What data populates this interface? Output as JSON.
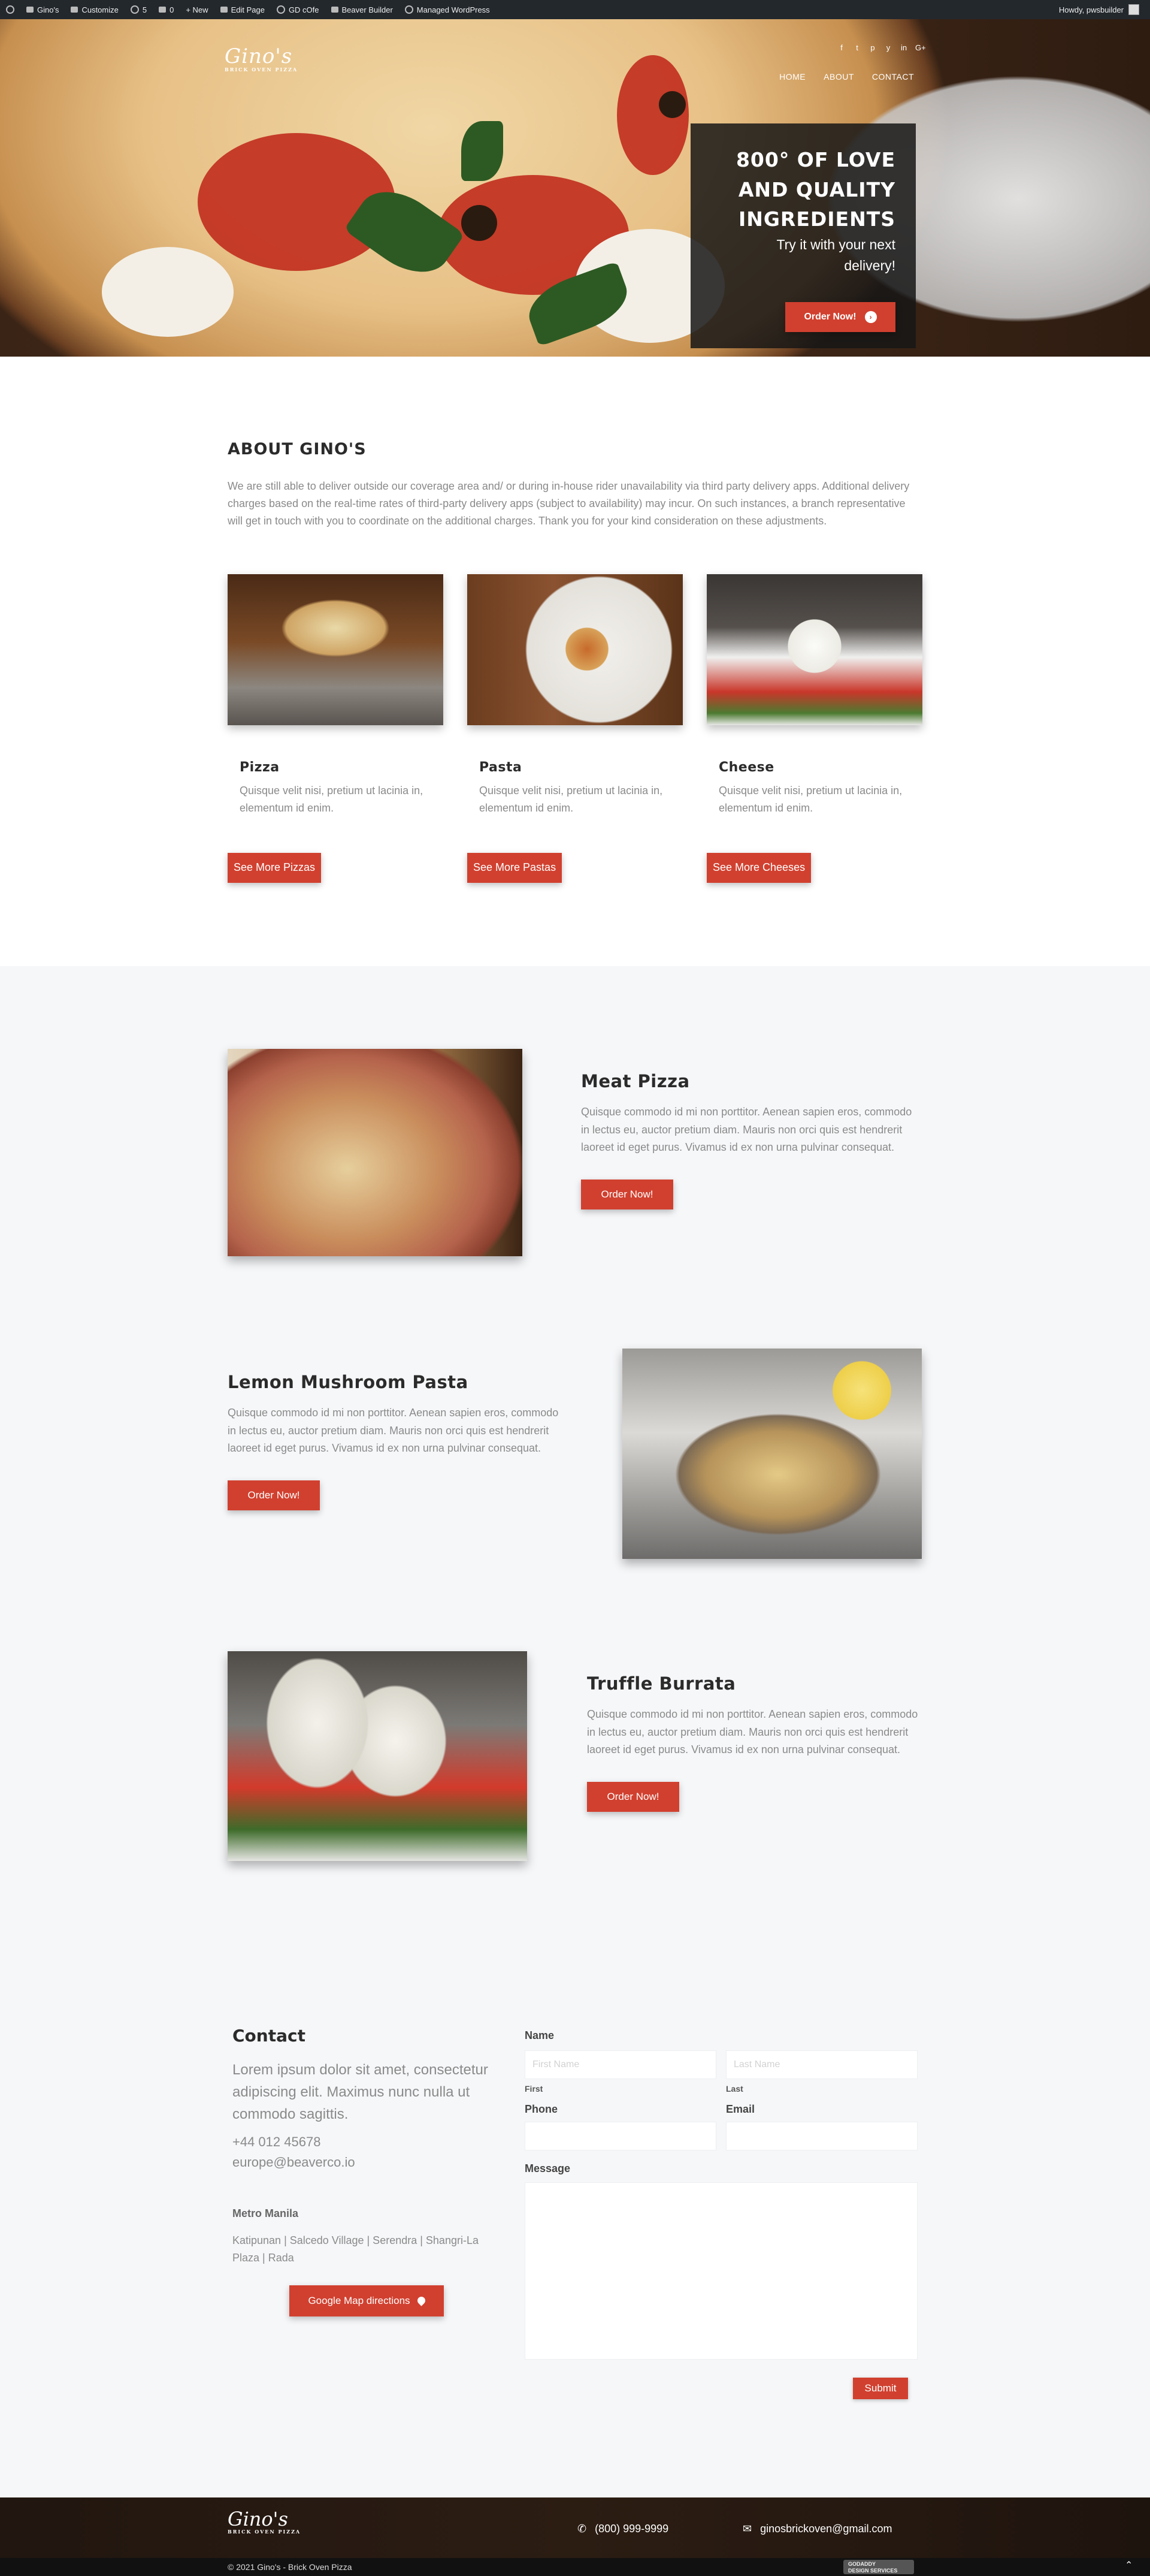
{
  "adminbar": {
    "items": [
      "Gino's",
      "Customize",
      "5",
      "0",
      "+ New",
      "Edit Page",
      "GD cOfe",
      "Beaver Builder",
      "Managed WordPress"
    ],
    "greeting": "Howdy, pwsbuilder"
  },
  "hero": {
    "logo": "Gino's",
    "logo_sub": "BRICK OVEN PIZZA",
    "social_icons": [
      "facebook-icon",
      "twitter-icon",
      "pinterest-icon",
      "yelp-icon",
      "linkedin-icon",
      "google-plus-icon"
    ],
    "social_glyphs": [
      "f",
      "t",
      "p",
      "y",
      "in",
      "G+"
    ],
    "nav": [
      "HOME",
      "ABOUT",
      "CONTACT"
    ],
    "promo_title_lines": [
      "800° OF LOVE",
      "AND QUALITY",
      "INGREDIENTS"
    ],
    "promo_sub_lines": [
      "Try it with your next",
      "delivery!"
    ],
    "order_button": "Order Now!"
  },
  "about": {
    "title": "ABOUT GINO'S",
    "intro": "We are still able to deliver outside our coverage area and/ or during in-house rider unavailability via third party delivery apps. Additional delivery charges based on the real-time rates of third-party delivery apps (subject to availability) may incur. On such instances, a branch representative will get in touch with you to coordinate on the additional charges. Thank you for your kind consideration on these adjustments.",
    "cards": [
      {
        "title": "Pizza",
        "text": "Quisque velit nisi, pretium ut lacinia in, elementum id enim.",
        "button": "See More Pizzas"
      },
      {
        "title": "Pasta",
        "text": "Quisque velit nisi, pretium ut lacinia in, elementum id enim.",
        "button": "See More Pastas"
      },
      {
        "title": "Cheese",
        "text": "Quisque velit nisi, pretium ut lacinia in, elementum id enim.",
        "button": "See More Cheeses"
      }
    ]
  },
  "features": [
    {
      "title": "Meat Pizza",
      "text": "Quisque commodo id mi non porttitor. Aenean sapien eros, commodo in lectus eu, auctor pretium diam. Mauris non orci quis est hendrerit laoreet id eget purus. Vivamus id ex non urna pulvinar consequat.",
      "button": "Order Now!"
    },
    {
      "title": "Lemon Mushroom Pasta",
      "text": "Quisque commodo id mi non porttitor. Aenean sapien eros, commodo in lectus eu, auctor pretium diam. Mauris non orci quis est hendrerit laoreet id eget purus. Vivamus id ex non urna pulvinar consequat.",
      "button": "Order Now!"
    },
    {
      "title": "Truffle Burrata",
      "text": "Quisque commodo id mi non porttitor. Aenean sapien eros, commodo in lectus eu, auctor pretium diam. Mauris non orci quis est hendrerit laoreet id eget purus. Vivamus id ex non urna pulvinar consequat.",
      "button": "Order Now!"
    }
  ],
  "contact": {
    "title": "Contact",
    "lead": "Lorem ipsum dolor sit amet, consectetur adipiscing elit. Maximus nunc nulla ut commodo sagittis.",
    "phone": "+44 012 45678",
    "email": "europe@beaverco.io",
    "city": "Metro Manila",
    "branches": "Katipunan | Salcedo Village | Serendra | Shangri-La Plaza | Rada",
    "map_button": "Google Map directions"
  },
  "form": {
    "name_label": "Name",
    "first_placeholder": "First Name",
    "last_placeholder": "Last Name",
    "first_sub": "First",
    "last_sub": "Last",
    "phone_label": "Phone",
    "email_label": "Email",
    "message_label": "Message",
    "submit": "Submit"
  },
  "footer": {
    "logo": "Gino's",
    "logo_sub": "BRICK OVEN PIZZA",
    "phone": "(800) 999-9999",
    "email": "ginosbrickoven@gmail.com",
    "copyright": "© 2021 Gino's - Brick Oven Pizza",
    "badge_lines": [
      "GODADDY",
      "DESIGN SERVICES"
    ]
  },
  "colors": {
    "accent": "#d1402f",
    "admin_bar": "#23282d",
    "section_bg": "#f6f7f9"
  }
}
